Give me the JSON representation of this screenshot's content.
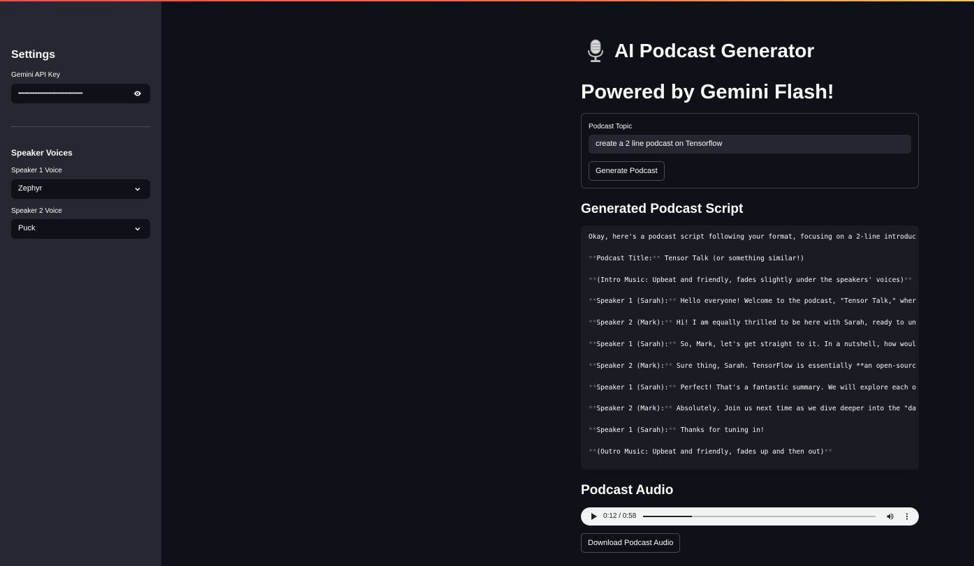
{
  "sidebar": {
    "settings_heading": "Settings",
    "api_key_label": "Gemini API Key",
    "api_key_value": "••••••••••••••••••••••••••••••••••••••••",
    "voices_heading": "Speaker Voices",
    "speaker1_label": "Speaker 1 Voice",
    "speaker1_value": "Zephyr",
    "speaker2_label": "Speaker 2 Voice",
    "speaker2_value": "Puck"
  },
  "main": {
    "title": "AI Podcast Generator",
    "subtitle": "Powered by Gemini Flash!",
    "topic_label": "Podcast Topic",
    "topic_value": "create a 2 line podcast on Tensorflow",
    "generate_button": "Generate Podcast",
    "script_heading": "Generated Podcast Script",
    "script_lines": [
      {
        "pre": "",
        "bold": "",
        "post": "Okay, here's a podcast script following your format, focusing on a 2-line introduc"
      },
      {
        "pre": "**",
        "bold": "Podcast Title:",
        "post": " Tensor Talk (or something similar!)"
      },
      {
        "pre": "**",
        "bold": "(Intro Music: Upbeat and friendly, fades slightly under the speakers' voices)",
        "post": ""
      },
      {
        "pre": "**",
        "bold": "Speaker 1 (Sarah):",
        "post": " Hello everyone! Welcome to the podcast, \"Tensor Talk,\" wher"
      },
      {
        "pre": "**",
        "bold": "Speaker 2 (Mark):",
        "post": " Hi! I am equally thrilled to be here with Sarah, ready to un"
      },
      {
        "pre": "**",
        "bold": "Speaker 1 (Sarah):",
        "post": " So, Mark, let's get straight to it. In a nutshell, how woul"
      },
      {
        "pre": "**",
        "bold": "Speaker 2 (Mark):",
        "post": " Sure thing, Sarah. TensorFlow is essentially **an open-sourc"
      },
      {
        "pre": "**",
        "bold": "Speaker 1 (Sarah):",
        "post": " Perfect! That's a fantastic summary. We will explore each o"
      },
      {
        "pre": "**",
        "bold": "Speaker 2 (Mark):",
        "post": " Absolutely. Join us next time as we dive deeper into the \"da"
      },
      {
        "pre": "**",
        "bold": "Speaker 1 (Sarah):",
        "post": " Thanks for tuning in!"
      },
      {
        "pre": "**",
        "bold": "(Outro Music: Upbeat and friendly, fades up and then out)",
        "post": ""
      }
    ],
    "audio_heading": "Podcast Audio",
    "audio_time": "0:12 / 0:58",
    "audio_progress": 0.21,
    "download_button": "Download Podcast Audio"
  },
  "colors": {
    "background": "#0e1117",
    "sidebar": "#262730",
    "accent": "#ff4b4b"
  },
  "icons": [
    "microphone-icon",
    "eye-icon",
    "chevron-down-icon",
    "play-icon",
    "volume-icon",
    "more-vert-icon"
  ]
}
